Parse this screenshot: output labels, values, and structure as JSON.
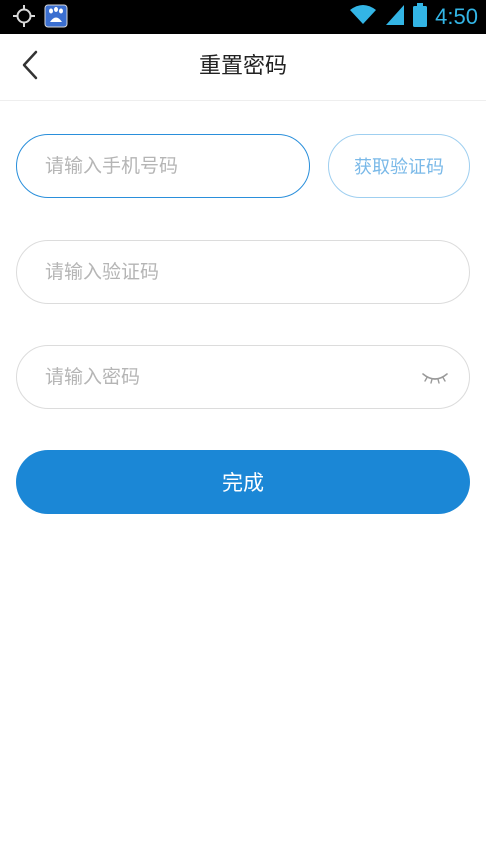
{
  "status_bar": {
    "time": "4:50",
    "icons": [
      "gps-icon",
      "baidu-app-icon",
      "wifi-icon",
      "signal-icon",
      "battery-icon"
    ],
    "accent_color": "#33b5e5"
  },
  "header": {
    "title": "重置密码",
    "back_icon": "chevron-left-icon"
  },
  "form": {
    "phone_placeholder": "请输入手机号码",
    "phone_value": "",
    "get_code_label": "获取验证码",
    "code_placeholder": "请输入验证码",
    "code_value": "",
    "password_placeholder": "请输入密码",
    "password_value": "",
    "password_toggle_icon": "eye-closed-icon",
    "submit_label": "完成"
  },
  "colors": {
    "primary": "#1b87d6",
    "focus_border": "#2a8fdb",
    "placeholder": "#b5b5b5"
  }
}
